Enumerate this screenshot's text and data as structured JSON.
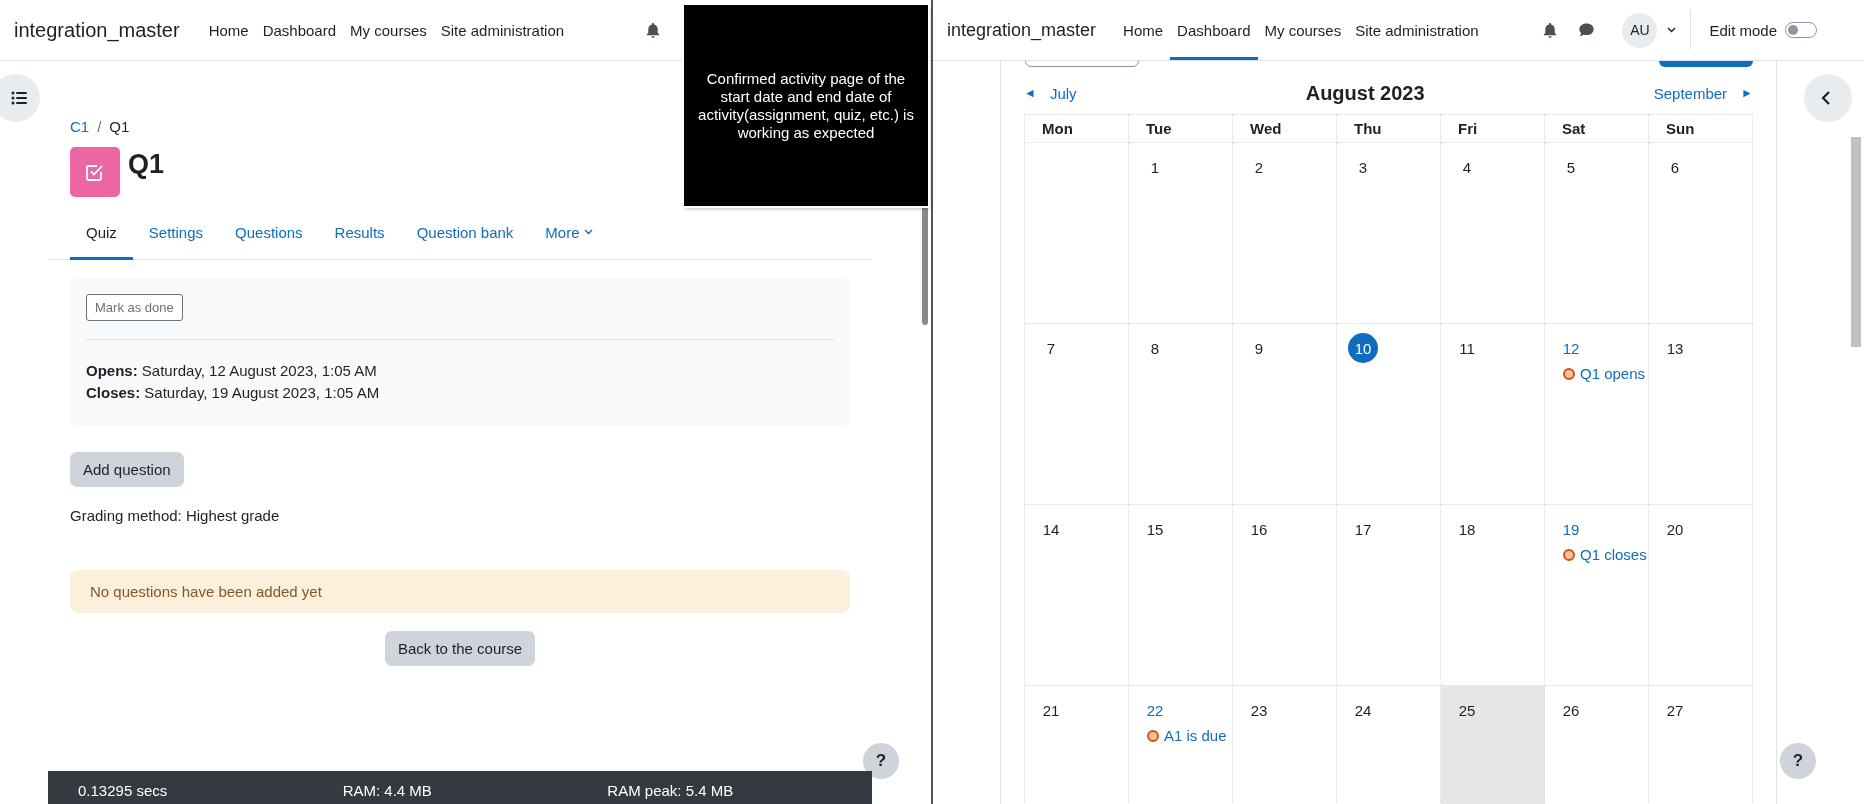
{
  "left": {
    "navbar": {
      "brand": "integration_master",
      "links": [
        {
          "label": "Home",
          "selected": false
        },
        {
          "label": "Dashboard",
          "selected": false
        },
        {
          "label": "My courses",
          "selected": false
        },
        {
          "label": "Site administration",
          "selected": false
        }
      ]
    },
    "breadcrumb": [
      "C1",
      "Q1"
    ],
    "separator": "/",
    "title": "Q1",
    "tabs": [
      {
        "label": "Quiz",
        "selected": true,
        "kind": "link"
      },
      {
        "label": "Settings",
        "selected": false,
        "kind": "link"
      },
      {
        "label": "Questions",
        "selected": false,
        "kind": "link"
      },
      {
        "label": "Results",
        "selected": false,
        "kind": "link"
      },
      {
        "label": "Question bank",
        "selected": false,
        "kind": "link"
      },
      {
        "label": "More",
        "selected": false,
        "kind": "dropdown"
      }
    ],
    "mark_button": "Mark as done",
    "dates": [
      {
        "label": "Opens:",
        "value": "Saturday, 12 August 2023, 1:05 AM"
      },
      {
        "label": "Closes:",
        "value": "Saturday, 19 August 2023, 1:05 AM"
      }
    ],
    "add_button": "Add question",
    "grading": "Grading method: Highest grade",
    "alert": "No questions have been added yet",
    "back_button": "Back to the course",
    "help": "?",
    "footer": [
      "0.13295 secs",
      "RAM: 4.4 MB",
      "RAM peak: 5.4 MB"
    ]
  },
  "note": "Confirmed activity page of the start date and end date of activity(assignment, quiz, etc.) is working as expected",
  "right": {
    "navbar": {
      "brand": "integration_master",
      "links": [
        {
          "label": "Home",
          "selected": false
        },
        {
          "label": "Dashboard",
          "selected": true
        },
        {
          "label": "My courses",
          "selected": false
        },
        {
          "label": "Site administration",
          "selected": false
        }
      ],
      "avatar": "AU",
      "edit_mode": {
        "label": "Edit mode",
        "on": false
      }
    },
    "calendar": {
      "prev_arrow": "◄",
      "prev": "July",
      "title": "August 2023",
      "next": "September",
      "next_arrow": "►",
      "weekdays": [
        "Mon",
        "Tue",
        "Wed",
        "Thu",
        "Fri",
        "Sat",
        "Sun"
      ],
      "weeks": [
        [
          {
            "kind": "blank"
          },
          {
            "kind": "day",
            "day": "1",
            "today": false,
            "highlighted": false
          },
          {
            "kind": "day",
            "day": "2",
            "today": false,
            "highlighted": false
          },
          {
            "kind": "day",
            "day": "3",
            "today": false,
            "highlighted": false
          },
          {
            "kind": "day",
            "day": "4",
            "today": false,
            "highlighted": false
          },
          {
            "kind": "day",
            "day": "5",
            "today": false,
            "highlighted": false
          },
          {
            "kind": "day",
            "day": "6",
            "today": false,
            "highlighted": false
          }
        ],
        [
          {
            "kind": "day",
            "day": "7",
            "today": false,
            "highlighted": false
          },
          {
            "kind": "day",
            "day": "8",
            "today": false,
            "highlighted": false
          },
          {
            "kind": "day",
            "day": "9",
            "today": false,
            "highlighted": false
          },
          {
            "kind": "day",
            "day": "10",
            "today": true,
            "highlighted": false
          },
          {
            "kind": "day",
            "day": "11",
            "today": false,
            "highlighted": false
          },
          {
            "kind": "day",
            "day": "12",
            "today": false,
            "highlighted": false,
            "events": [
              "Q1 opens"
            ]
          },
          {
            "kind": "day",
            "day": "13",
            "today": false,
            "highlighted": false
          }
        ],
        [
          {
            "kind": "day",
            "day": "14",
            "today": false,
            "highlighted": false
          },
          {
            "kind": "day",
            "day": "15",
            "today": false,
            "highlighted": false
          },
          {
            "kind": "day",
            "day": "16",
            "today": false,
            "highlighted": false
          },
          {
            "kind": "day",
            "day": "17",
            "today": false,
            "highlighted": false
          },
          {
            "kind": "day",
            "day": "18",
            "today": false,
            "highlighted": false
          },
          {
            "kind": "day",
            "day": "19",
            "today": false,
            "highlighted": false,
            "events": [
              "Q1 closes"
            ]
          },
          {
            "kind": "day",
            "day": "20",
            "today": false,
            "highlighted": false
          }
        ],
        [
          {
            "kind": "day",
            "day": "21",
            "today": false,
            "highlighted": false
          },
          {
            "kind": "day",
            "day": "22",
            "today": false,
            "highlighted": false,
            "events": [
              "A1 is due"
            ]
          },
          {
            "kind": "day",
            "day": "23",
            "today": false,
            "highlighted": false
          },
          {
            "kind": "day",
            "day": "24",
            "today": false,
            "highlighted": false
          },
          {
            "kind": "day",
            "day": "25",
            "today": false,
            "highlighted": true
          },
          {
            "kind": "day",
            "day": "26",
            "today": false,
            "highlighted": false
          },
          {
            "kind": "day",
            "day": "27",
            "today": false,
            "highlighted": false
          }
        ]
      ]
    },
    "help": "?"
  }
}
